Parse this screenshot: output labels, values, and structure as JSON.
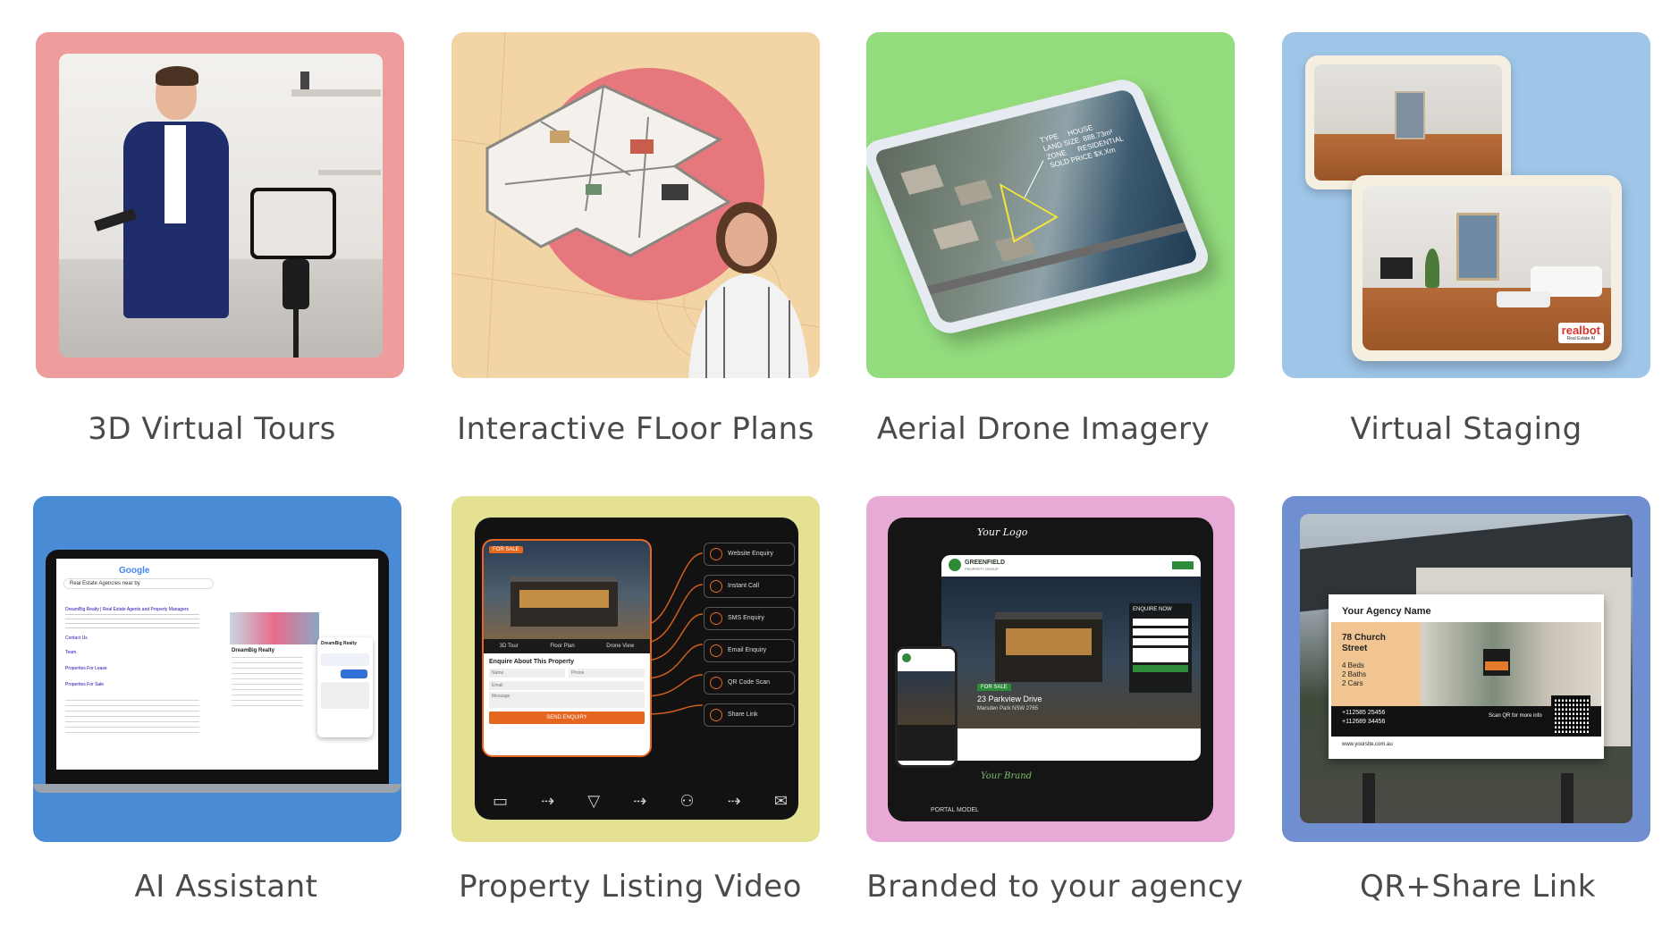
{
  "features": [
    {
      "label": "3D Virtual Tours",
      "bg": "#ee9c9c"
    },
    {
      "label": "Interactive FLoor Plans",
      "bg": "#f3d4a4"
    },
    {
      "label": "Aerial Drone Imagery",
      "bg": "#94dd7e"
    },
    {
      "label": "Virtual Staging",
      "bg": "#9fc6e8"
    },
    {
      "label": "AI Assistant",
      "bg": "#4a8bd6"
    },
    {
      "label": "Property Listing Video",
      "bg": "#e4e292"
    },
    {
      "label": "Branded to your agency",
      "bg": "#e7a9d6"
    },
    {
      "label": "QR+Share Link",
      "bg": "#6f8fd0"
    }
  ],
  "drone": {
    "type_label": "TYPE",
    "type_value": "HOUSE",
    "land_label": "LAND SIZE",
    "land_value": "888.73m²",
    "zone_label": "ZONE",
    "zone_value": "RESIDENTIAL",
    "price_label": "SOLD PRICE",
    "price_value": "$X.Xm"
  },
  "staging": {
    "logo": "realbot",
    "logo_sub": "Real Estate AI"
  },
  "ai": {
    "google": "Google",
    "query": "Real Estate Agencies near by",
    "result_title": "DreamBig Realty | Real Estate Agents and Property Managers",
    "contact": "Contact Us",
    "team": "Team",
    "lease": "Properties For Lease",
    "sale": "Properties For Sale",
    "side_title": "DreamBig Realty",
    "chat_title": "DreamBig Realty"
  },
  "video": {
    "badge": "FOR SALE",
    "tab1": "3D Tour",
    "tab2": "Floor Plan",
    "tab3": "Drone View",
    "form_title": "Enquire About This Property",
    "f_name": "Name",
    "f_phone": "Phone",
    "f_email": "Email",
    "f_message": "Message",
    "send": "SEND ENQUIRY",
    "options": [
      "Website Enquiry",
      "Instant Call",
      "SMS Enquiry",
      "Email Enquiry",
      "QR Code Scan",
      "Share Link"
    ]
  },
  "brand": {
    "your_logo": "Your Logo",
    "company": "GREENFIELD",
    "company_sub": "PROPERTY GROUP",
    "badge": "FOR SALE",
    "address": "23 Parkview Drive",
    "suburb": "Marsden Park NSW 2765",
    "enquire": "ENQUIRE NOW",
    "your_brand": "Your Brand",
    "portal": "PORTAL MODEL"
  },
  "sign": {
    "agency": "Your Agency Name",
    "address_line1": "78 Church",
    "address_line2": "Street",
    "beds": "4 Beds",
    "baths": "2 Baths",
    "cars": "2 Cars",
    "phone1": "+112585 25456",
    "phone2": "+112689 34456",
    "scan": "Scan QR for more info",
    "website": "www.yoursite.com.au"
  }
}
